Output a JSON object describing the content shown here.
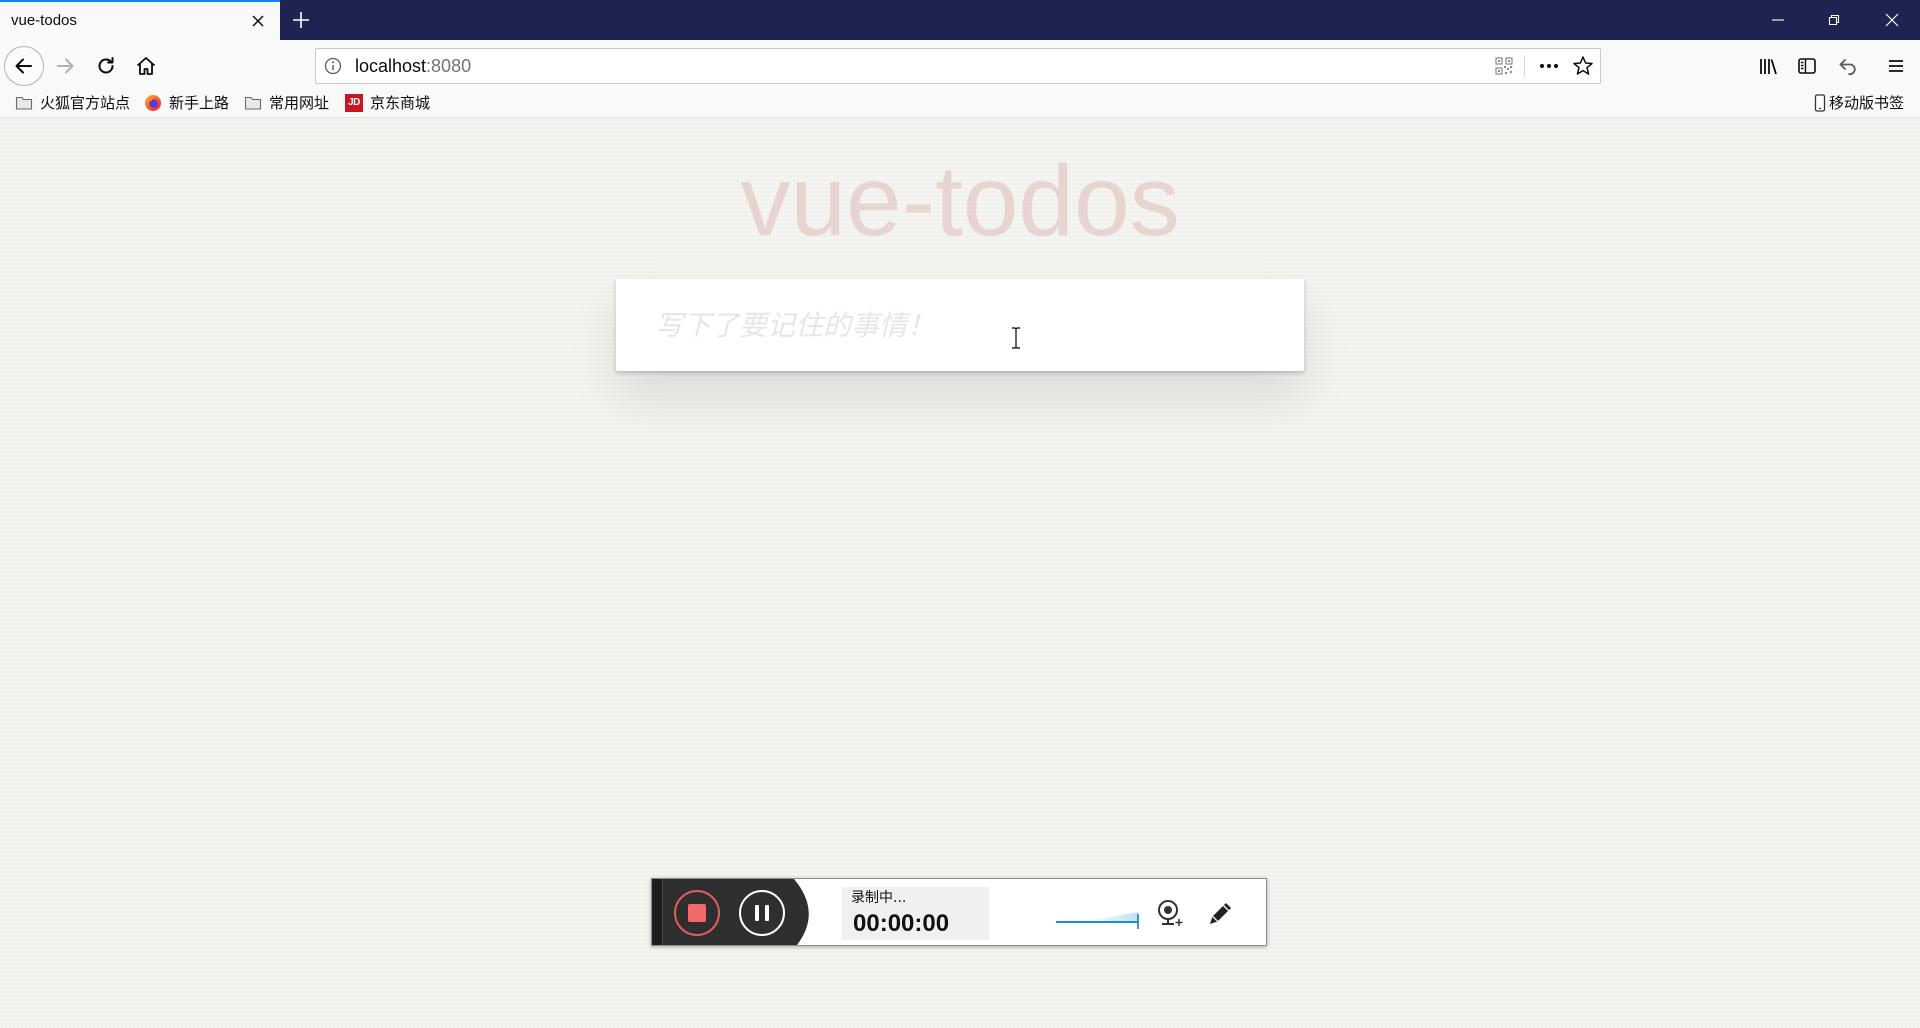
{
  "browser": {
    "tab": {
      "title": "vue-todos"
    },
    "address": {
      "host": "localhost",
      "rest": ":8080"
    },
    "bookmarks": [
      {
        "label": "火狐官方站点",
        "icon": "folder-icon"
      },
      {
        "label": "新手上路",
        "icon": "firefox-icon"
      },
      {
        "label": "常用网址",
        "icon": "folder-icon"
      },
      {
        "label": "京东商城",
        "icon": "jd-icon",
        "logo_text": "JD"
      }
    ],
    "mobile_bookmarks": {
      "label": "移动版书签",
      "icon": "phone-icon"
    }
  },
  "app": {
    "title": "vue-todos",
    "new_todo": {
      "placeholder": "写下了要记住的事情！",
      "value": ""
    }
  },
  "recorder": {
    "status": "录制中...",
    "elapsed": "00:00:00"
  },
  "colors": {
    "tab_bar": "#1d2451",
    "tab_accent": "#0a84ff",
    "app_title": "rgba(175,47,47,0.15)",
    "record_red": "#e45c5c",
    "volume_blue": "#1a8fd6"
  }
}
